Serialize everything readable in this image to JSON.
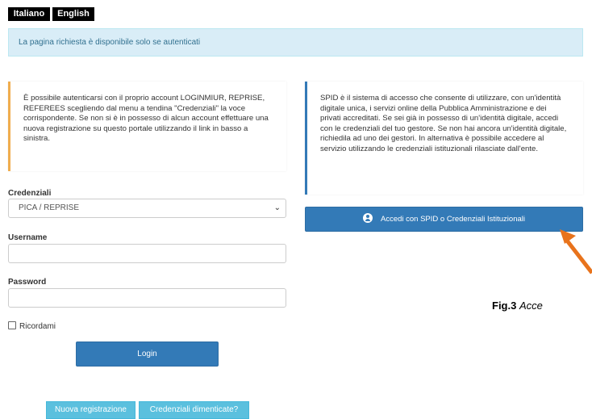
{
  "languages": {
    "italian": "Italiano",
    "english": "English"
  },
  "alert": "La pagina richiesta è disponibile solo se autenticati",
  "left_info": "È possibile autenticarsi con il proprio account LOGINMIUR, REPRISE, REFEREES scegliendo dal menu a tendina \"Credenziali\" la voce corrispondente. Se non si è in possesso di alcun account effettuare una nuova registrazione su questo portale utilizzando il link in basso a sinistra.",
  "right_info": "SPID è il sistema di accesso che consente di utilizzare, con un'identità digitale unica, i servizi online della Pubblica Amministrazione e dei privati accreditati. Se sei già in possesso di un'identità digitale, accedi con le credenziali del tuo gestore. Se non hai ancora un'identità digitale, richiedila ad uno dei gestori. In alternativa è possibile accedere al servizio utilizzando le credenziali istituzionali rilasciate dall'ente.",
  "form": {
    "credentials_label": "Credenziali",
    "credentials_value": "PICA / REPRISE",
    "username_label": "Username",
    "username_value": "",
    "password_label": "Password",
    "password_value": "",
    "remember_label": "Ricordami",
    "login_button": "Login"
  },
  "buttons": {
    "register": "Nuova registrazione",
    "forgot": "Credenziali dimenticate?",
    "spid": "Accedi con SPID o Credenziali Istituzionali"
  },
  "caption": {
    "fig": "Fig.3",
    "text": "Acce"
  },
  "colors": {
    "primary": "#337ab7",
    "info": "#5bc0de",
    "warning": "#f0ad4e",
    "arrow": "#e8731c"
  }
}
